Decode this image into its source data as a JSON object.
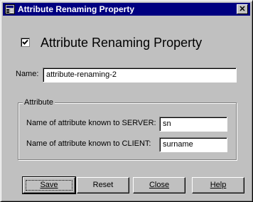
{
  "window": {
    "title": "Attribute Renaming Property",
    "close_glyph": "✕"
  },
  "form": {
    "enabled_checked": true,
    "heading": "Attribute Renaming Property",
    "name_label": "Name:",
    "name_value": "attribute-renaming-2"
  },
  "attribute_group": {
    "legend": "Attribute",
    "server_label": "Name of attribute known to SERVER:",
    "server_value": "sn",
    "client_label": "Name of attribute known to CLIENT:",
    "client_value": "surname"
  },
  "buttons": {
    "save": "Save",
    "reset": "Reset",
    "close": "Close",
    "help": "Help"
  },
  "icons": [
    "app-icon",
    "close-icon",
    "checkmark-icon"
  ]
}
